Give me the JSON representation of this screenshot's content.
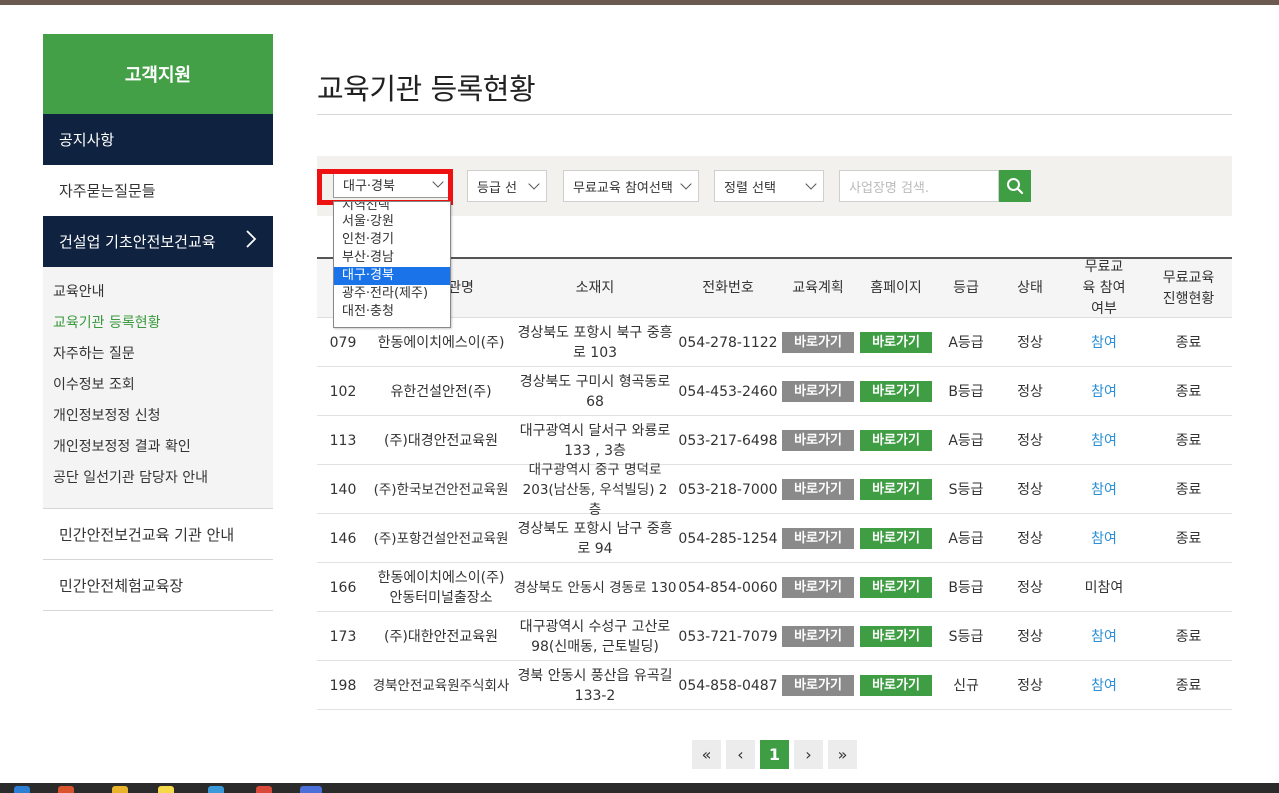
{
  "sidebar": {
    "title": "고객지원",
    "notice": "공지사항",
    "faq": "자주묻는질문들",
    "section": "건설업 기초안전보건교육",
    "submenu": [
      "교육안내",
      "교육기관 등록현황",
      "자주하는 질문",
      "이수정보 조회",
      "개인정보정정 신청",
      "개인정보정정 결과 확인",
      "공단 일선기관 담당자 안내"
    ],
    "private_edu": "민간안전보건교육 기관 안내",
    "experience": "민간안전체험교육장"
  },
  "page": {
    "title": "교육기관 등록현황"
  },
  "filters": {
    "region_selected": "대구·경북",
    "grade": "등급 선",
    "free_edu": "무료교육 참여선택",
    "sort": "정렬 선택",
    "search_placeholder": "사업장명 검색."
  },
  "region_options": [
    "지역선택",
    "서울·강원",
    "인천·경기",
    "부산·경남",
    "대구·경북",
    "광주·전라(제주)",
    "대전·충청"
  ],
  "table": {
    "headers": {
      "no": "",
      "name": "관명",
      "address": "소재지",
      "phone": "전화번호",
      "plan": "교육계획",
      "homepage": "홈페이지",
      "grade": "등급",
      "status": "상태",
      "free_join": "무료교육 참여여부",
      "free_progress": "무료교육 진행현황"
    },
    "plan_label": "바로가기",
    "home_label": "바로가기",
    "rows": [
      {
        "no": "079",
        "name": "한동에이치에스이(주)",
        "address": "경상북도 포항시 북구 중흥로 103",
        "phone": "054-278-1122",
        "grade": "A등급",
        "status": "정상",
        "free_join": "참여",
        "free_progress": "종료"
      },
      {
        "no": "102",
        "name": "유한건설안전(주)",
        "address": "경상북도 구미시 형곡동로 68",
        "phone": "054-453-2460",
        "grade": "B등급",
        "status": "정상",
        "free_join": "참여",
        "free_progress": "종료"
      },
      {
        "no": "113",
        "name": "(주)대경안전교육원",
        "address": "대구광역시 달서구 와룡로 133 , 3층",
        "phone": "053-217-6498",
        "grade": "A등급",
        "status": "정상",
        "free_join": "참여",
        "free_progress": "종료"
      },
      {
        "no": "140",
        "name": "(주)한국보건안전교육원",
        "address": "대구광역시 중구 명덕로 203(남산동, 우석빌딩) 2층",
        "phone": "053-218-7000",
        "grade": "S등급",
        "status": "정상",
        "free_join": "참여",
        "free_progress": "종료"
      },
      {
        "no": "146",
        "name": "(주)포항건설안전교육원",
        "address": "경상북도 포항시 남구 중흥로 94",
        "phone": "054-285-1254",
        "grade": "A등급",
        "status": "정상",
        "free_join": "참여",
        "free_progress": "종료"
      },
      {
        "no": "166",
        "name": "한동에이치에스이(주) 안동터미널출장소",
        "address": "경상북도 안동시 경동로 130",
        "phone": "054-854-0060",
        "grade": "B등급",
        "status": "정상",
        "free_join": "미참여",
        "free_progress": ""
      },
      {
        "no": "173",
        "name": "(주)대한안전교육원",
        "address": "대구광역시 수성구 고산로 98(신매동, 근토빌딩)",
        "phone": "053-721-7079",
        "grade": "S등급",
        "status": "정상",
        "free_join": "참여",
        "free_progress": "종료"
      },
      {
        "no": "198",
        "name": "경북안전교육원주식회사",
        "address": "경북 안동시 풍산읍 유곡길 133-2",
        "phone": "054-858-0487",
        "grade": "신규",
        "status": "정상",
        "free_join": "참여",
        "free_progress": "종료"
      }
    ]
  },
  "pagination": {
    "first": "«",
    "prev": "‹",
    "current": "1",
    "next": "›",
    "last": "»"
  },
  "colors": {
    "green": "#43a047",
    "navy": "#0f2240",
    "link": "#2a8fd6",
    "highlight": "#ee1111"
  }
}
